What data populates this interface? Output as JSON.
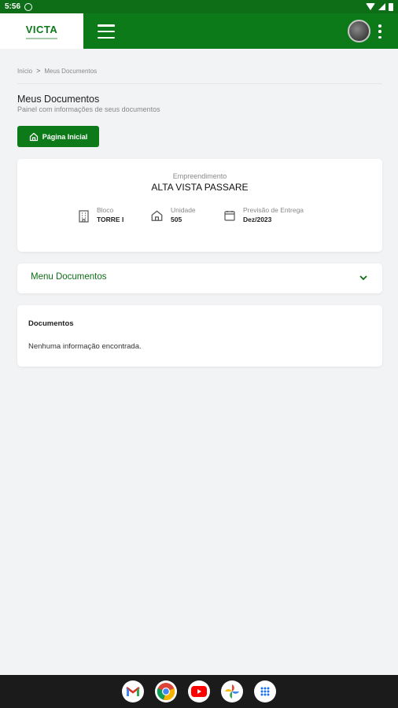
{
  "status_bar": {
    "time": "5:56"
  },
  "app_bar": {
    "logo": "VICTA"
  },
  "breadcrumb": {
    "home": "Início",
    "separator": ">",
    "current": "Meus Documentos"
  },
  "page": {
    "title": "Meus Documentos",
    "subtitle": "Painel com informações de seus documentos",
    "home_button": "Página Inicial"
  },
  "empreendimento": {
    "label": "Empreendimento",
    "name": "ALTA VISTA PASSARE",
    "bloco": {
      "label": "Bloco",
      "value": "TORRE I"
    },
    "unidade": {
      "label": "Unidade",
      "value": "505"
    },
    "previsao": {
      "label": "Previsão de Entrega",
      "value": "Dez/2023"
    }
  },
  "menu_documentos": {
    "title": "Menu Documentos"
  },
  "documentos": {
    "title": "Documentos",
    "empty_message": "Nenhuma informação encontrada."
  },
  "dock": {
    "apps": [
      "gmail-icon",
      "chrome-icon",
      "youtube-icon",
      "photos-icon",
      "app-drawer-icon"
    ]
  },
  "colors": {
    "primary": "#0d7a1a",
    "statusbar": "#0d6e17",
    "background": "#f2f3f5"
  }
}
